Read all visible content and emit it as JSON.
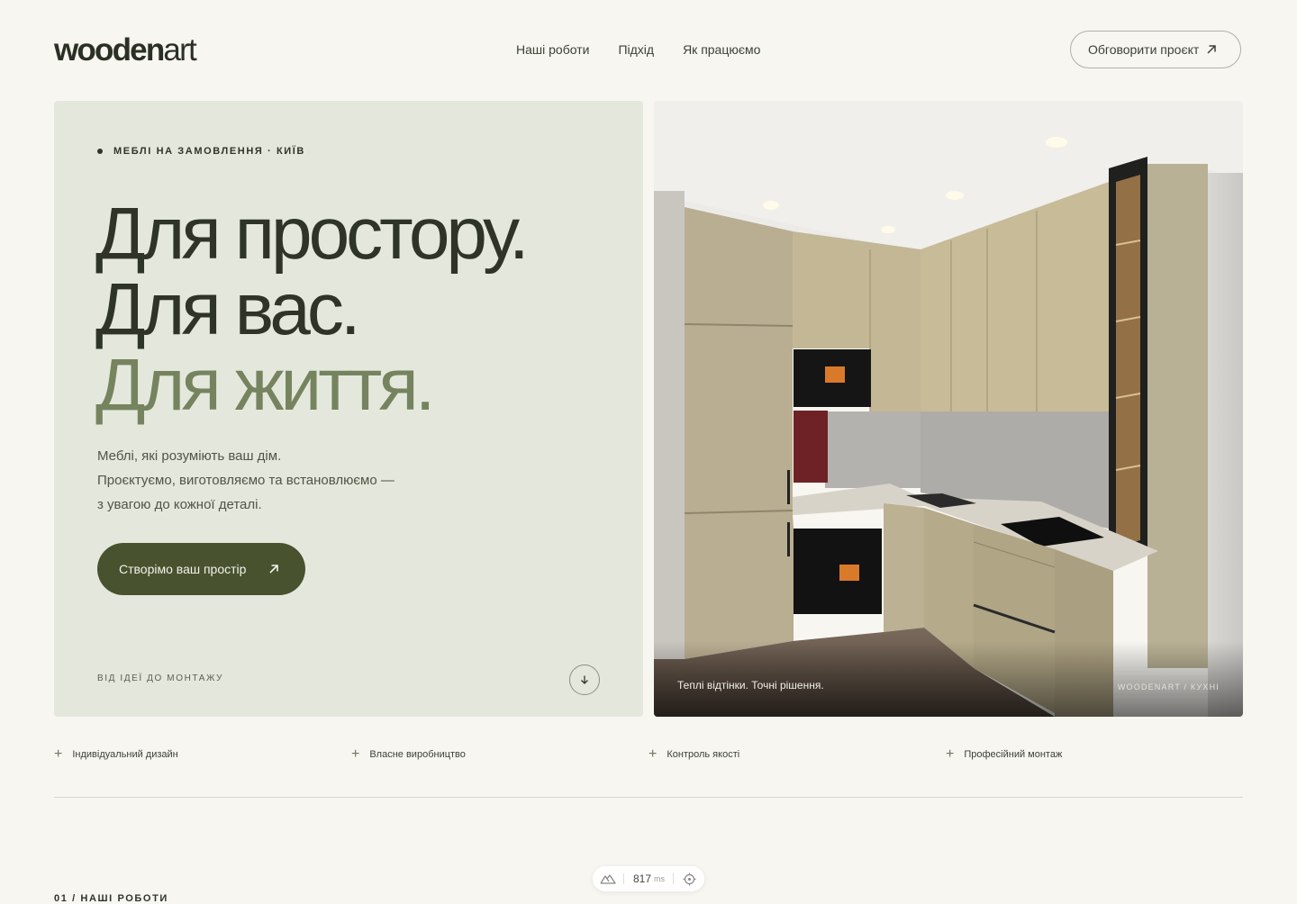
{
  "header": {
    "logo_bold": "wooden",
    "logo_light": "art",
    "nav": [
      "Наші роботи",
      "Підхід",
      "Як працюємо"
    ],
    "cta": "Обговорити проєкт"
  },
  "hero": {
    "eyebrow": "МЕБЛІ НА ЗАМОВЛЕННЯ · КИЇВ",
    "headline": [
      "Для простору.",
      "Для вас.",
      "Для життя."
    ],
    "lead": [
      "Меблі, які розуміють ваш дім.",
      "Проєктуємо, виготовляємо та встановлюємо —",
      "з увагою до кожної деталі."
    ],
    "button": "Створімо ваш простір",
    "footer_label": "ВІД ІДЕЇ ДО МОНТАЖУ",
    "accent_colors": {
      "dark": "#2e3427",
      "olive": "#76835f",
      "button": "#48522f",
      "panel": "#e4e8dc"
    }
  },
  "hero_image": {
    "caption": "Теплі відтінки. Точні рішення.",
    "credit": "WOODENART / КУХНІ"
  },
  "features": [
    "Індивідуальний дизайн",
    "Власне виробництво",
    "Контроль якості",
    "Професійний монтаж"
  ],
  "section": {
    "label": "01 / НАШІ РОБОТИ"
  },
  "toolbar": {
    "value": "817",
    "unit": "ms",
    "icons": [
      "nuxt-logo-icon",
      "crosshair-icon"
    ]
  },
  "icons": {
    "arrow": "arrow-up-right-icon",
    "scroll": "arrow-down-icon",
    "feature": "plus-icon"
  }
}
